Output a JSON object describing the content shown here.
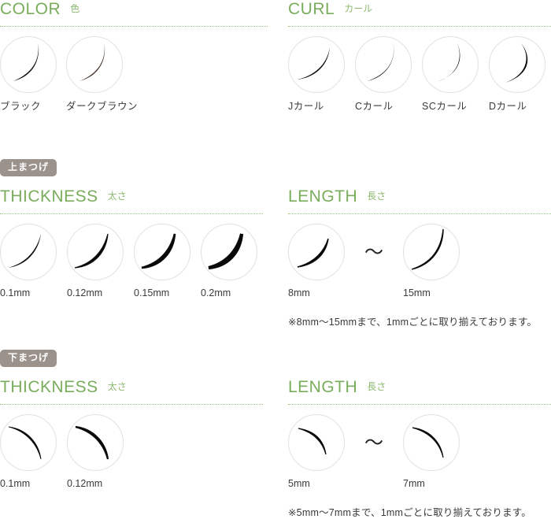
{
  "theme": {
    "green": "#79ad5c",
    "green_light": "#8cb96f",
    "dotted": "#9cc47f",
    "badge_bg": "#9c928c",
    "circle_border": "#e2e2e2",
    "text": "#3a3a3a",
    "lash_black": "#0a0a0a",
    "lash_brown": "#4a3a32"
  },
  "sections": {
    "color": {
      "heading_en": "COLOR",
      "heading_jp": "色",
      "items": [
        {
          "label": "ブラック",
          "icon": "lash-crescent-icon",
          "color": "#0a0a0a"
        },
        {
          "label": "ダークブラウン",
          "icon": "lash-crescent-icon",
          "color": "#4a3a32"
        }
      ]
    },
    "curl": {
      "heading_en": "CURL",
      "heading_jp": "カール",
      "items": [
        {
          "label": "Jカール",
          "icon": "lash-curl-j-icon"
        },
        {
          "label": "Cカール",
          "icon": "lash-curl-c-icon"
        },
        {
          "label": "SCカール",
          "icon": "lash-curl-sc-icon"
        },
        {
          "label": "Dカール",
          "icon": "lash-curl-d-icon"
        }
      ]
    },
    "upper": {
      "badge": "上まつげ",
      "thickness": {
        "heading_en": "THICKNESS",
        "heading_jp": "太さ",
        "items": [
          {
            "label": "0.1mm",
            "icon": "lash-thickness-icon"
          },
          {
            "label": "0.12mm",
            "icon": "lash-thickness-icon"
          },
          {
            "label": "0.15mm",
            "icon": "lash-thickness-icon"
          },
          {
            "label": "0.2mm",
            "icon": "lash-thickness-icon"
          }
        ]
      },
      "length": {
        "heading_en": "LENGTH",
        "heading_jp": "長さ",
        "separator": "〜",
        "items": [
          {
            "label": "8mm",
            "icon": "lash-length-icon"
          },
          {
            "label": "15mm",
            "icon": "lash-length-icon"
          }
        ],
        "note": "※8mm〜15mmまで、1mmごとに取り揃えております。"
      }
    },
    "lower": {
      "badge": "下まつげ",
      "thickness": {
        "heading_en": "THICKNESS",
        "heading_jp": "太さ",
        "items": [
          {
            "label": "0.1mm",
            "icon": "lash-thickness-icon"
          },
          {
            "label": "0.12mm",
            "icon": "lash-thickness-icon"
          }
        ]
      },
      "length": {
        "heading_en": "LENGTH",
        "heading_jp": "長さ",
        "separator": "〜",
        "items": [
          {
            "label": "5mm",
            "icon": "lash-length-icon"
          },
          {
            "label": "7mm",
            "icon": "lash-length-icon"
          }
        ],
        "note": "※5mm〜7mmまで、1mmごとに取り揃えております。"
      }
    }
  }
}
